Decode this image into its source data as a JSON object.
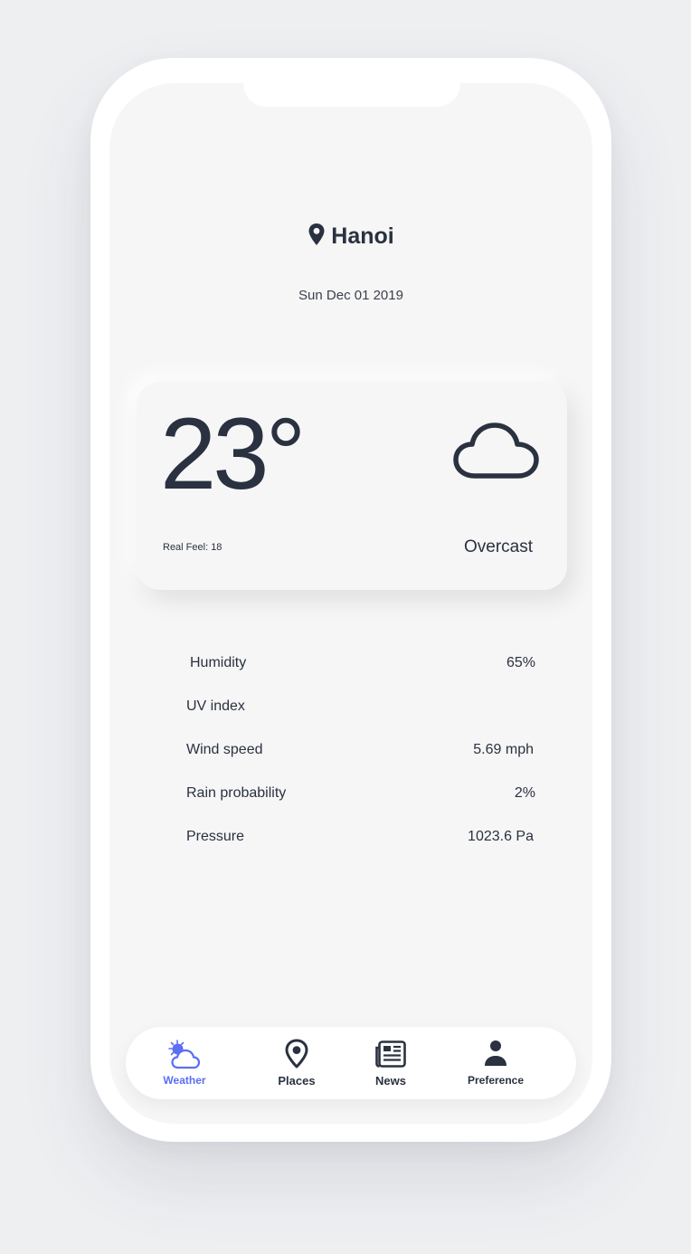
{
  "location": {
    "city": "Hanoi",
    "icon": "map-pin-icon"
  },
  "date": "Sun Dec 01 2019",
  "current": {
    "temperature": "23°",
    "real_feel": "Real Feel: 18",
    "condition": "Overcast",
    "condition_icon": "cloud-icon"
  },
  "stats": [
    {
      "label": "Humidity",
      "value": "65%"
    },
    {
      "label": "UV index",
      "value": ""
    },
    {
      "label": "Wind speed",
      "value": "5.69 mph"
    },
    {
      "label": "Rain probability",
      "value": "2%"
    },
    {
      "label": "Pressure",
      "value": "1023.6 Pa"
    }
  ],
  "nav": [
    {
      "label": "Weather",
      "icon": "sun-cloud-icon",
      "active": true
    },
    {
      "label": "Places",
      "icon": "location-icon",
      "active": false
    },
    {
      "label": "News",
      "icon": "newspaper-icon",
      "active": false
    },
    {
      "label": "Preference",
      "icon": "person-icon",
      "active": false
    }
  ],
  "colors": {
    "accent": "#5b6ef5",
    "text": "#2a3140",
    "background": "#f6f6f6",
    "sun": "#5b6ef5"
  }
}
